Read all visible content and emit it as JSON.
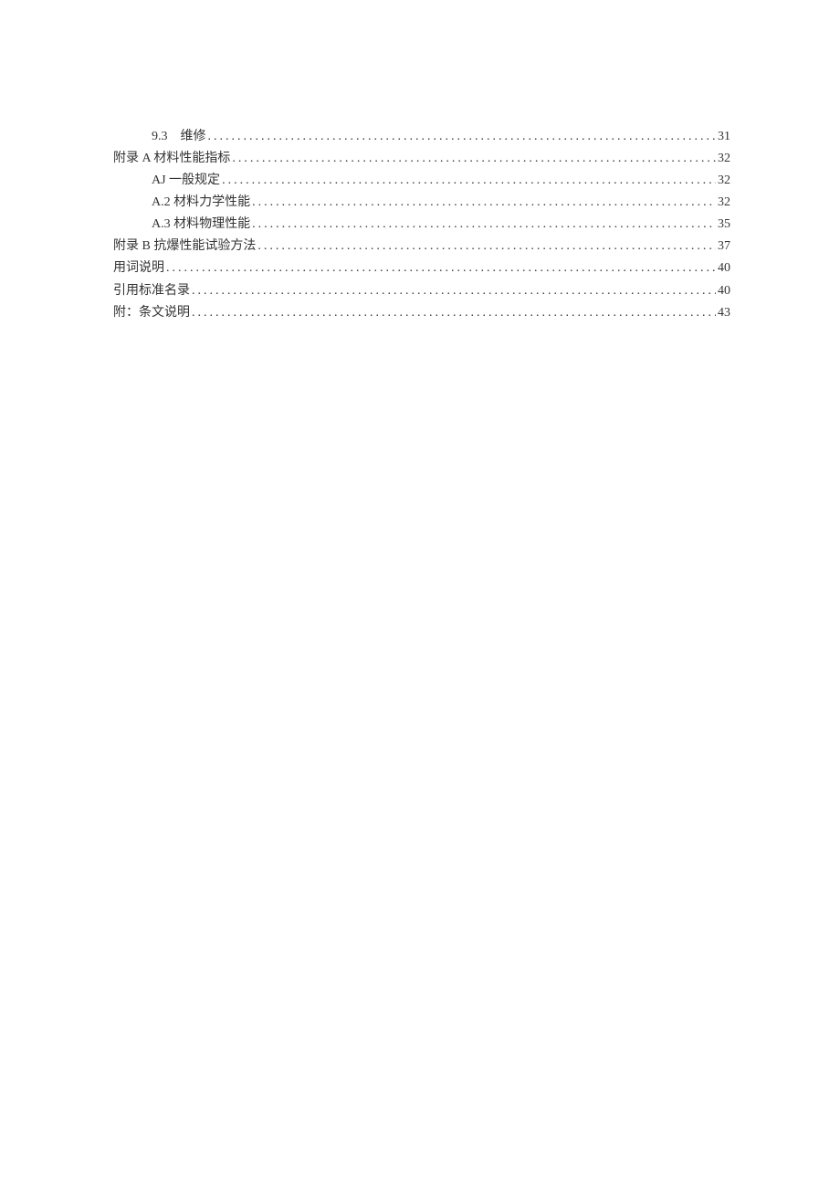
{
  "toc": [
    {
      "indent": 2,
      "title": "9.3　维修",
      "page": "31"
    },
    {
      "indent": 1,
      "title": "附录 A 材料性能指标",
      "page": "32"
    },
    {
      "indent": 2,
      "title": "AJ 一般规定",
      "page": "32"
    },
    {
      "indent": 2,
      "title": "A.2 材料力学性能",
      "page": "32"
    },
    {
      "indent": 2,
      "title": "A.3 材料物理性能",
      "page": "35"
    },
    {
      "indent": 1,
      "title": "附录 B 抗爆性能试验方法",
      "page": "37"
    },
    {
      "indent": 1,
      "title": "用词说明",
      "page": "40"
    },
    {
      "indent": 1,
      "title": "引用标准名录",
      "page": "40"
    },
    {
      "indent": 1,
      "title": "附：条文说明",
      "page": "43"
    }
  ]
}
